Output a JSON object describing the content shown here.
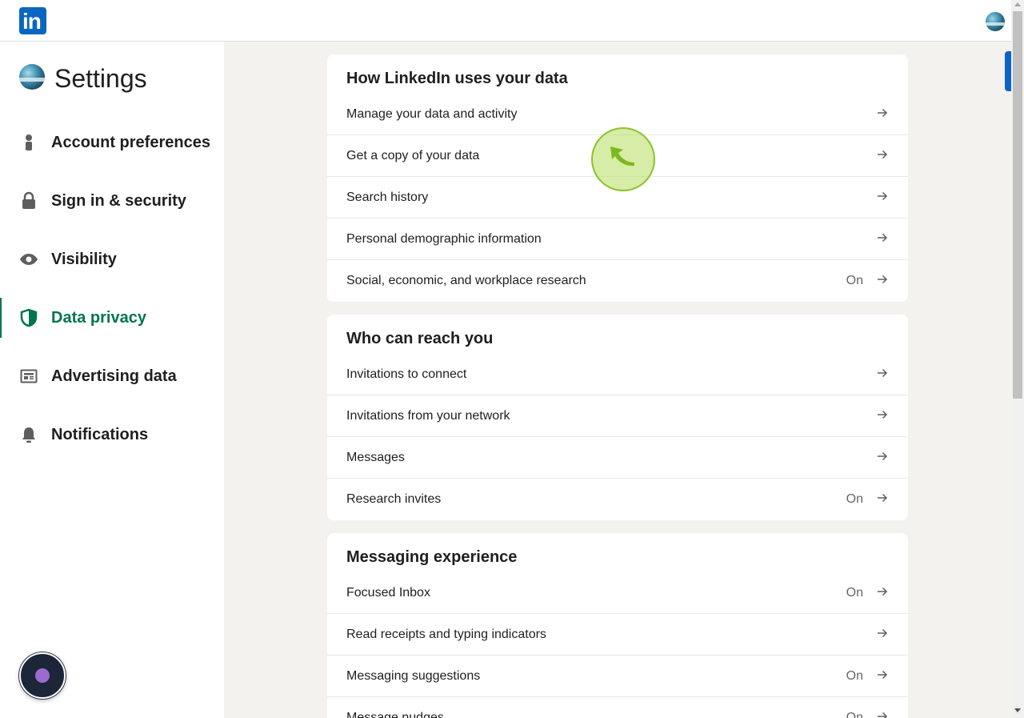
{
  "header": {
    "logo_text": "in"
  },
  "sidebar": {
    "title": "Settings",
    "items": [
      {
        "label": "Account preferences",
        "icon": "person-icon",
        "active": false
      },
      {
        "label": "Sign in & security",
        "icon": "lock-icon",
        "active": false
      },
      {
        "label": "Visibility",
        "icon": "eye-icon",
        "active": false
      },
      {
        "label": "Data privacy",
        "icon": "shield-icon",
        "active": true
      },
      {
        "label": "Advertising data",
        "icon": "newspaper-icon",
        "active": false
      },
      {
        "label": "Notifications",
        "icon": "bell-icon",
        "active": false
      }
    ],
    "active_color": "#01754f"
  },
  "sections": [
    {
      "title": "How LinkedIn uses your data",
      "rows": [
        {
          "label": "Manage your data and activity",
          "status": ""
        },
        {
          "label": "Get a copy of your data",
          "status": ""
        },
        {
          "label": "Search history",
          "status": ""
        },
        {
          "label": "Personal demographic information",
          "status": ""
        },
        {
          "label": "Social, economic, and workplace research",
          "status": "On"
        }
      ]
    },
    {
      "title": "Who can reach you",
      "rows": [
        {
          "label": "Invitations to connect",
          "status": ""
        },
        {
          "label": "Invitations from your network",
          "status": ""
        },
        {
          "label": "Messages",
          "status": ""
        },
        {
          "label": "Research invites",
          "status": "On"
        }
      ]
    },
    {
      "title": "Messaging experience",
      "rows": [
        {
          "label": "Focused Inbox",
          "status": "On"
        },
        {
          "label": "Read receipts and typing indicators",
          "status": ""
        },
        {
          "label": "Messaging suggestions",
          "status": "On"
        },
        {
          "label": "Message nudges",
          "status": "On"
        }
      ]
    }
  ],
  "colors": {
    "brand": "#0a66c2",
    "background": "#f4f2ee",
    "click_indicator": "#b6dd5c"
  }
}
